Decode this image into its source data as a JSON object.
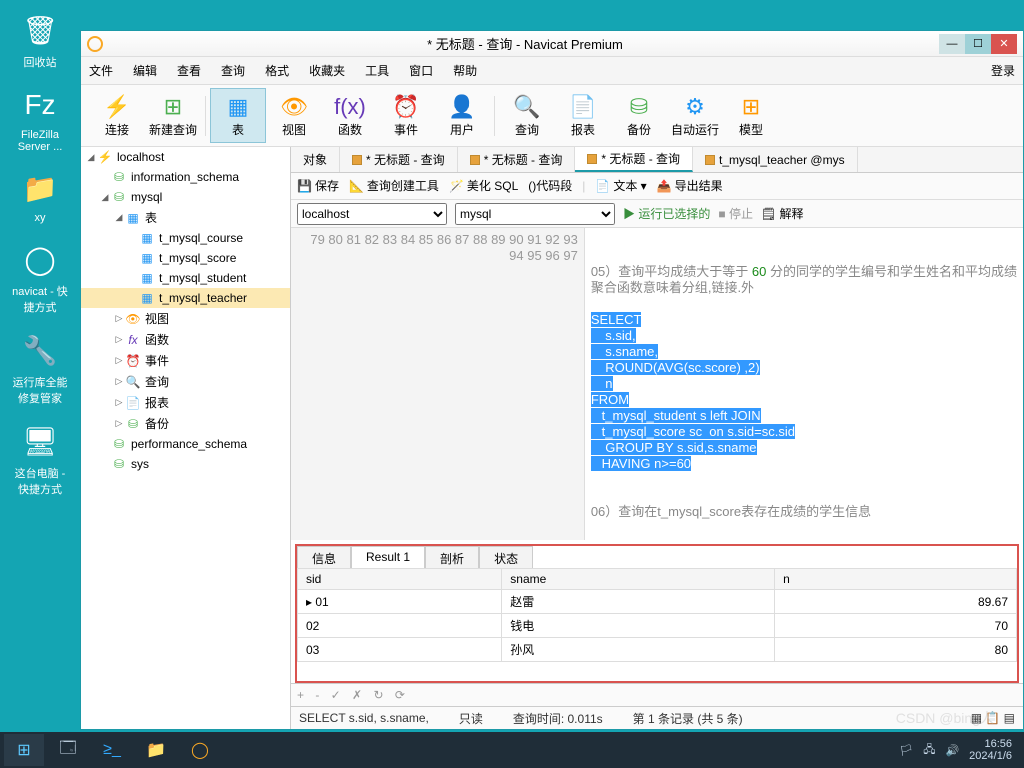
{
  "desktop": {
    "icons": [
      {
        "name": "recycle-bin",
        "label": "回收站",
        "glyph": "🗑"
      },
      {
        "name": "filezilla",
        "label": "FileZilla Server ...",
        "glyph": "Fz"
      },
      {
        "name": "folder-xy",
        "label": "xy",
        "glyph": "📁"
      },
      {
        "name": "navicat",
        "label": "navicat - 快捷方式",
        "glyph": "◯"
      },
      {
        "name": "runtime-fix",
        "label": "运行库全能修复管家",
        "glyph": "🔧"
      },
      {
        "name": "this-pc",
        "label": "这台电脑 - 快捷方式",
        "glyph": "🖥"
      }
    ]
  },
  "window": {
    "title": "* 无标题 - 查询 - Navicat Premium"
  },
  "menubar": {
    "items": [
      "文件",
      "编辑",
      "查看",
      "查询",
      "格式",
      "收藏夹",
      "工具",
      "窗口",
      "帮助"
    ],
    "login": "登录"
  },
  "maintoolbar": {
    "items": [
      {
        "name": "connect",
        "label": "连接",
        "glyph": "⚡",
        "accent": "#4caf50"
      },
      {
        "name": "new-query",
        "label": "新建查询",
        "glyph": "⊞",
        "accent": "#4caf50"
      },
      {
        "name": "table",
        "label": "表",
        "glyph": "▦",
        "accent": "#2196f3",
        "active": true
      },
      {
        "name": "view",
        "label": "视图",
        "glyph": "👁",
        "accent": "#ff9800"
      },
      {
        "name": "function",
        "label": "函数",
        "glyph": "f(x)",
        "accent": "#673ab7"
      },
      {
        "name": "event",
        "label": "事件",
        "glyph": "⏰",
        "accent": "#ff9800"
      },
      {
        "name": "user",
        "label": "用户",
        "glyph": "👤",
        "accent": "#ff9800"
      },
      {
        "name": "query",
        "label": "查询",
        "glyph": "🔍",
        "accent": "#2196f3"
      },
      {
        "name": "report",
        "label": "报表",
        "glyph": "📄",
        "accent": "#2196f3"
      },
      {
        "name": "backup",
        "label": "备份",
        "glyph": "⛁",
        "accent": "#4caf50"
      },
      {
        "name": "autorun",
        "label": "自动运行",
        "glyph": "⚙",
        "accent": "#2196f3"
      },
      {
        "name": "model",
        "label": "模型",
        "glyph": "⊞",
        "accent": "#ff9800"
      }
    ]
  },
  "sidebar": {
    "connection": "localhost",
    "dbs": {
      "info_schema": "information_schema",
      "mysql": "mysql",
      "tables_label": "表",
      "tables": [
        "t_mysql_course",
        "t_mysql_score",
        "t_mysql_student",
        "t_mysql_teacher"
      ],
      "views": "视图",
      "functions": "函数",
      "events": "事件",
      "queries": "查询",
      "reports": "报表",
      "backups": "备份",
      "perf": "performance_schema",
      "sys": "sys"
    }
  },
  "tabs": {
    "items": [
      {
        "label": "对象"
      },
      {
        "label": "* 无标题 - 查询"
      },
      {
        "label": "* 无标题 - 查询"
      },
      {
        "label": "* 无标题 - 查询",
        "active": true
      },
      {
        "label": "t_mysql_teacher @mys"
      }
    ]
  },
  "querytoolbar": {
    "save": "保存",
    "builder": "查询创建工具",
    "beautify": "美化 SQL",
    "segment": "()代码段",
    "text": "文本 ▾",
    "export": "导出结果"
  },
  "connbar": {
    "conn": "localhost",
    "db": "mysql",
    "run": "运行已选择的",
    "stop": "停止",
    "explain": "解释"
  },
  "editor": {
    "lines": [
      {
        "n": 79,
        "t": ""
      },
      {
        "n": 80,
        "t": ""
      },
      {
        "n": 81,
        "t": "05）查询平均成绩大于等于 60 分的同学的学生编号和学生姓名和平均成绩",
        "comment": true,
        "box": "top"
      },
      {
        "n": 82,
        "t": "聚合函数意味着分组,链接.外",
        "comment": true,
        "box": "bottom"
      },
      {
        "n": 83,
        "t": ""
      },
      {
        "n": 84,
        "t": "SELECT",
        "sel": true,
        "inbox": "start"
      },
      {
        "n": 85,
        "t": "    s.sid,",
        "sel": true
      },
      {
        "n": 86,
        "t": "    s.sname,",
        "sel": true
      },
      {
        "n": 87,
        "t": "    ROUND(AVG(sc.score) ,2)",
        "sel": true
      },
      {
        "n": 88,
        "t": "    n",
        "sel": true
      },
      {
        "n": 89,
        "t": "FROM",
        "sel": true
      },
      {
        "n": 90,
        "t": "   t_mysql_student s left JOIN",
        "sel": true
      },
      {
        "n": 91,
        "t": "   t_mysql_score sc  on s.sid=sc.sid",
        "sel": true
      },
      {
        "n": 92,
        "t": "    GROUP BY s.sid,s.sname",
        "sel": true
      },
      {
        "n": 93,
        "t": "   HAVING n>=60",
        "sel": true,
        "inbox": "end"
      },
      {
        "n": 94,
        "t": ""
      },
      {
        "n": 95,
        "t": ""
      },
      {
        "n": 96,
        "t": "06）查询在t_mysql_score表存在成绩的学生信息",
        "comment": true
      },
      {
        "n": 97,
        "t": ""
      }
    ]
  },
  "result": {
    "tabs": [
      "信息",
      "Result 1",
      "剖析",
      "状态"
    ],
    "active": 1,
    "columns": [
      "sid",
      "sname",
      "n"
    ],
    "rows": [
      {
        "sid": "01",
        "sname": "赵雷",
        "n": "89.67",
        "current": true
      },
      {
        "sid": "02",
        "sname": "钱电",
        "n": "70"
      },
      {
        "sid": "03",
        "sname": "孙风",
        "n": "80"
      }
    ],
    "footer_icons": "+  -  ✓  ✗  ↻  ⟳"
  },
  "statusbar": {
    "sql": "SELECT         s.sid,         s.sname,",
    "readonly": "只读",
    "time": "查询时间: 0.011s",
    "records": "第 1 条记录 (共 5 条)"
  },
  "taskbar": {
    "time": "16:56",
    "date": "2024/1/6"
  },
  "watermark": "CSDN @bing人"
}
